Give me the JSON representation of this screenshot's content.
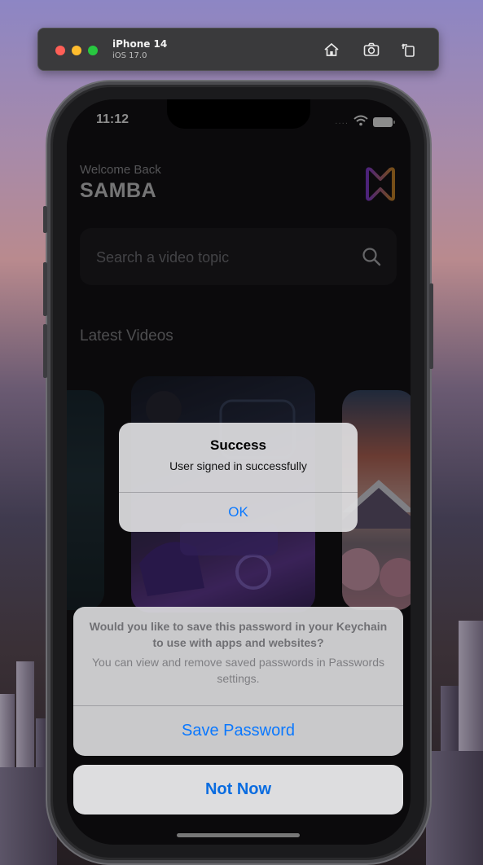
{
  "simulator": {
    "device_name": "iPhone 14",
    "os_version": "iOS 17.0",
    "icons": [
      "home-icon",
      "screenshot-icon",
      "rotate-icon"
    ]
  },
  "status_bar": {
    "time": "11:12",
    "signal": "....",
    "icons": [
      "wifi-icon",
      "battery-icon"
    ]
  },
  "header": {
    "welcome": "Welcome Back",
    "username": "SAMBA",
    "logo_icon": "samba-logo-icon",
    "logo_colors": [
      "#8b3fe0",
      "#d9902a"
    ]
  },
  "search": {
    "placeholder": "Search a video topic",
    "icon": "search-icon"
  },
  "section": {
    "title": "Latest Videos"
  },
  "alert": {
    "title": "Success",
    "message": "User signed in successfully",
    "button": "OK"
  },
  "keychain_sheet": {
    "title": "Would you like to save this password in your Keychain to use with apps and websites?",
    "message": "You can view and remove saved passwords in Passwords settings.",
    "save_button": "Save Password",
    "cancel_button": "Not Now"
  },
  "colors": {
    "ios_blue": "#0a78ff",
    "screen_bg": "#141316"
  }
}
